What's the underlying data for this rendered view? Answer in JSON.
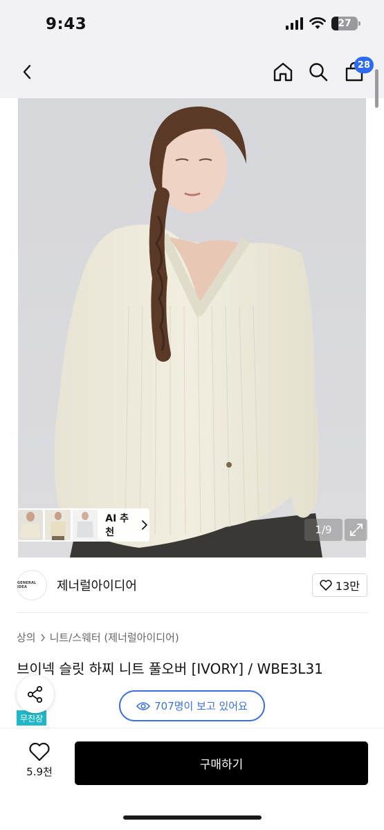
{
  "status_bar": {
    "time": "9:43",
    "battery": "27",
    "battery_level": 0.27
  },
  "nav": {
    "cart_count": "28"
  },
  "gallery": {
    "page_counter": "1/9",
    "ai_recommend_label": "AI 추천"
  },
  "brand": {
    "logo_text": "GENERAL IDEA",
    "name": "제너럴아이디어",
    "likes": "13만"
  },
  "breadcrumb": {
    "level1": "상의",
    "level2": "니트/스웨터 (제너럴아이디어)"
  },
  "product": {
    "title": "브이넥 슬릿 하찌 니트 풀오버 [IVORY] / WBE3L31",
    "tag": "무진장"
  },
  "viewers": {
    "text": "707명이 보고 있어요"
  },
  "bottom_bar": {
    "wish_count": "5.9천",
    "buy_label": "구매하기"
  },
  "colors": {
    "accent_blue": "#3b6fe0",
    "badge_blue": "#2d6cf0",
    "tag_teal": "#20b8c7",
    "buy_black": "#000000"
  }
}
